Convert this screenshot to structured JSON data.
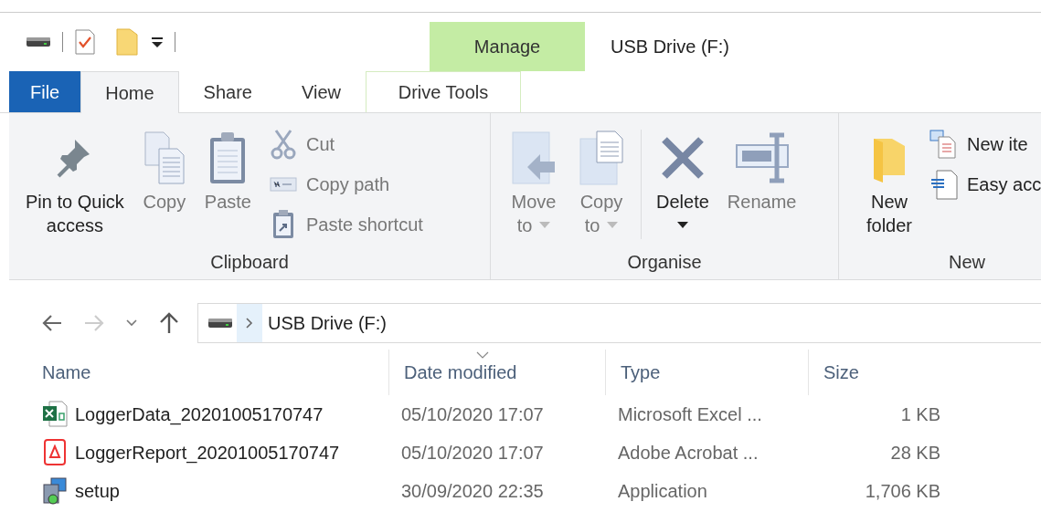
{
  "window": {
    "title": "USB Drive (F:)"
  },
  "context_tab": {
    "label": "Manage"
  },
  "tabs": [
    {
      "label": "File",
      "kind": "file",
      "selected": false
    },
    {
      "label": "Home",
      "kind": "tab",
      "selected": true
    },
    {
      "label": "Share",
      "kind": "tab",
      "selected": false
    },
    {
      "label": "View",
      "kind": "tab",
      "selected": false
    },
    {
      "label": "Drive Tools",
      "kind": "context",
      "selected": false
    }
  ],
  "ribbon": {
    "groups": [
      {
        "label": "Clipboard",
        "items": [
          {
            "kind": "large",
            "label": "Pin to Quick access",
            "disabled": false,
            "dropdown": false
          },
          {
            "kind": "large",
            "label": "Copy",
            "disabled": true,
            "dropdown": false
          },
          {
            "kind": "large",
            "label": "Paste",
            "disabled": true,
            "dropdown": false
          },
          {
            "kind": "stack",
            "items": [
              {
                "label": "Cut",
                "disabled": true
              },
              {
                "label": "Copy path",
                "disabled": true
              },
              {
                "label": "Paste shortcut",
                "disabled": true
              }
            ]
          }
        ]
      },
      {
        "label": "Organise",
        "items": [
          {
            "kind": "large",
            "label": "Move to",
            "disabled": true,
            "dropdown": true
          },
          {
            "kind": "large",
            "label": "Copy to",
            "disabled": true,
            "dropdown": true
          },
          {
            "kind": "separator"
          },
          {
            "kind": "large",
            "label": "Delete",
            "disabled": false,
            "dropdown": true
          },
          {
            "kind": "large",
            "label": "Rename",
            "disabled": true,
            "dropdown": false
          }
        ]
      },
      {
        "label": "New",
        "items": [
          {
            "kind": "large",
            "label": "New folder",
            "disabled": false,
            "dropdown": false
          },
          {
            "kind": "stack",
            "items": [
              {
                "label": "New ite",
                "disabled": false
              },
              {
                "label": "Easy acc",
                "disabled": false
              }
            ]
          }
        ]
      }
    ]
  },
  "address": {
    "path": "USB Drive (F:)"
  },
  "navigation": {
    "back_disabled": false,
    "forward_disabled": true
  },
  "table": {
    "columns": [
      {
        "label": "Name",
        "sorted": false
      },
      {
        "label": "Date modified",
        "sorted": true
      },
      {
        "label": "Type",
        "sorted": false
      },
      {
        "label": "Size",
        "sorted": false
      }
    ],
    "rows": [
      {
        "kind": "excel",
        "name": "LoggerData_20201005170747",
        "date": "05/10/2020 17:07",
        "type": "Microsoft Excel ...",
        "size": "1 KB"
      },
      {
        "kind": "pdf",
        "name": "LoggerReport_20201005170747",
        "date": "05/10/2020 17:07",
        "type": "Adobe Acrobat ...",
        "size": "28 KB"
      },
      {
        "kind": "setup",
        "name": "setup",
        "date": "30/09/2020 22:35",
        "type": "Application",
        "size": "1,706 KB"
      }
    ]
  }
}
